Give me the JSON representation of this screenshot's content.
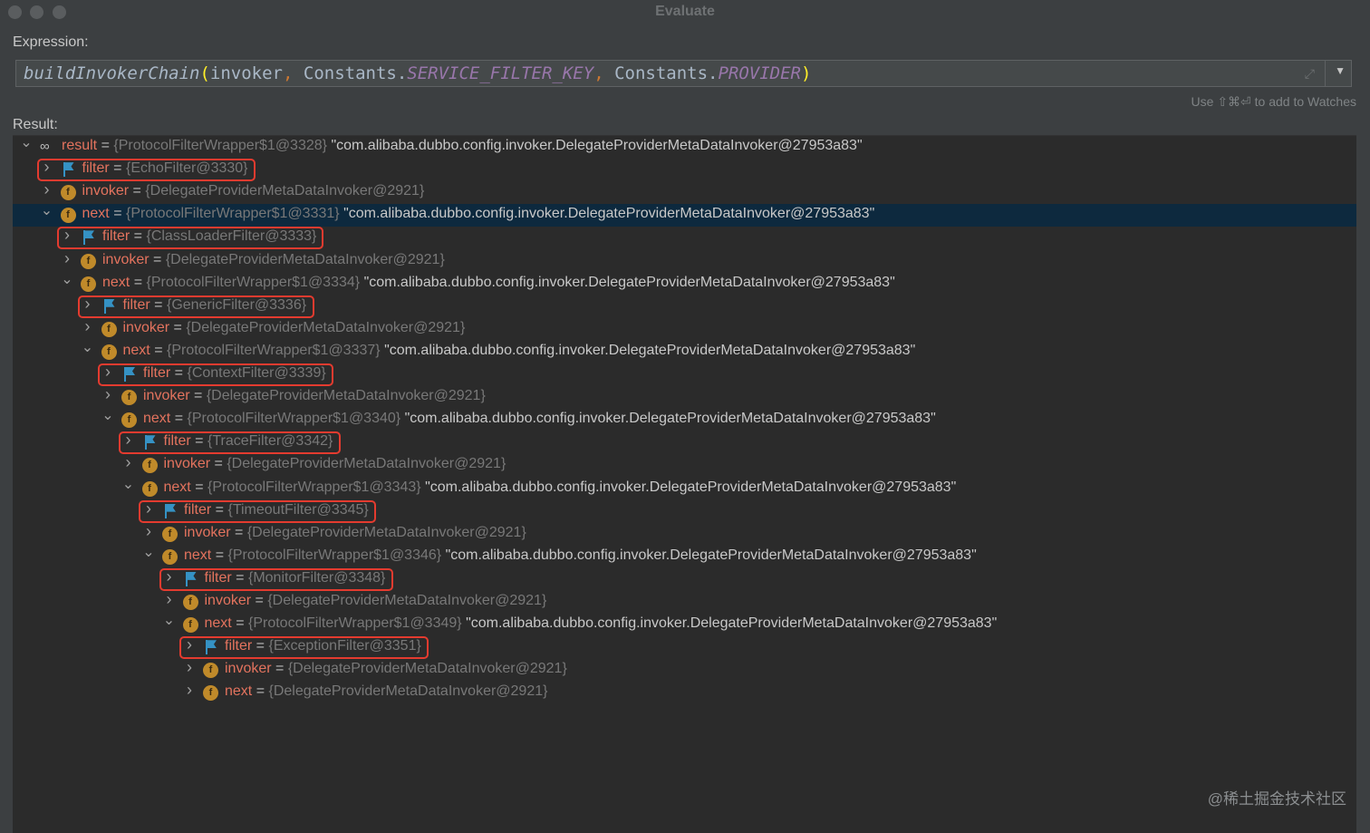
{
  "window": {
    "title": "Evaluate"
  },
  "expression": {
    "label": "Expression:",
    "fn": "buildInvokerChain",
    "open_paren": "(",
    "arg1": "invoker",
    "sep1": ", ",
    "class1": "Constants.",
    "const1": "SERVICE_FILTER_KEY",
    "sep2": ", ",
    "class2": "Constants.",
    "const2": "PROVIDER",
    "close_paren": ")"
  },
  "hint": "Use ⇧⌘⏎ to add to Watches",
  "result": {
    "label": "Result:",
    "rows": [
      {
        "depth": 0,
        "arrow": "down",
        "icon": "glasses",
        "name": "result",
        "type": "{ProtocolFilterWrapper$1@3328}",
        "str": "\"com.alibaba.dubbo.config.invoker.DelegateProviderMetaDataInvoker@27953a83\"",
        "selected": false,
        "highlight": false
      },
      {
        "depth": 1,
        "arrow": "right",
        "icon": "flag",
        "name": "filter",
        "type": "{EchoFilter@3330}",
        "str": "",
        "selected": false,
        "highlight": true
      },
      {
        "depth": 1,
        "arrow": "right",
        "icon": "field",
        "name": "invoker",
        "type": "{DelegateProviderMetaDataInvoker@2921}",
        "str": "",
        "selected": false,
        "highlight": false
      },
      {
        "depth": 1,
        "arrow": "down",
        "icon": "field",
        "name": "next",
        "type": "{ProtocolFilterWrapper$1@3331}",
        "str": "\"com.alibaba.dubbo.config.invoker.DelegateProviderMetaDataInvoker@27953a83\"",
        "selected": true,
        "highlight": false
      },
      {
        "depth": 2,
        "arrow": "right",
        "icon": "flag",
        "name": "filter",
        "type": "{ClassLoaderFilter@3333}",
        "str": "",
        "selected": false,
        "highlight": true
      },
      {
        "depth": 2,
        "arrow": "right",
        "icon": "field",
        "name": "invoker",
        "type": "{DelegateProviderMetaDataInvoker@2921}",
        "str": "",
        "selected": false,
        "highlight": false
      },
      {
        "depth": 2,
        "arrow": "down",
        "icon": "field",
        "name": "next",
        "type": "{ProtocolFilterWrapper$1@3334}",
        "str": "\"com.alibaba.dubbo.config.invoker.DelegateProviderMetaDataInvoker@27953a83\"",
        "selected": false,
        "highlight": false
      },
      {
        "depth": 3,
        "arrow": "right",
        "icon": "flag",
        "name": "filter",
        "type": "{GenericFilter@3336}",
        "str": "",
        "selected": false,
        "highlight": true
      },
      {
        "depth": 3,
        "arrow": "right",
        "icon": "field",
        "name": "invoker",
        "type": "{DelegateProviderMetaDataInvoker@2921}",
        "str": "",
        "selected": false,
        "highlight": false
      },
      {
        "depth": 3,
        "arrow": "down",
        "icon": "field",
        "name": "next",
        "type": "{ProtocolFilterWrapper$1@3337}",
        "str": "\"com.alibaba.dubbo.config.invoker.DelegateProviderMetaDataInvoker@27953a83\"",
        "selected": false,
        "highlight": false
      },
      {
        "depth": 4,
        "arrow": "right",
        "icon": "flag",
        "name": "filter",
        "type": "{ContextFilter@3339}",
        "str": "",
        "selected": false,
        "highlight": true
      },
      {
        "depth": 4,
        "arrow": "right",
        "icon": "field",
        "name": "invoker",
        "type": "{DelegateProviderMetaDataInvoker@2921}",
        "str": "",
        "selected": false,
        "highlight": false
      },
      {
        "depth": 4,
        "arrow": "down",
        "icon": "field",
        "name": "next",
        "type": "{ProtocolFilterWrapper$1@3340}",
        "str": "\"com.alibaba.dubbo.config.invoker.DelegateProviderMetaDataInvoker@27953a83\"",
        "selected": false,
        "highlight": false
      },
      {
        "depth": 5,
        "arrow": "right",
        "icon": "flag",
        "name": "filter",
        "type": "{TraceFilter@3342}",
        "str": "",
        "selected": false,
        "highlight": true
      },
      {
        "depth": 5,
        "arrow": "right",
        "icon": "field",
        "name": "invoker",
        "type": "{DelegateProviderMetaDataInvoker@2921}",
        "str": "",
        "selected": false,
        "highlight": false
      },
      {
        "depth": 5,
        "arrow": "down",
        "icon": "field",
        "name": "next",
        "type": "{ProtocolFilterWrapper$1@3343}",
        "str": "\"com.alibaba.dubbo.config.invoker.DelegateProviderMetaDataInvoker@27953a83\"",
        "selected": false,
        "highlight": false
      },
      {
        "depth": 6,
        "arrow": "right",
        "icon": "flag",
        "name": "filter",
        "type": "{TimeoutFilter@3345}",
        "str": "",
        "selected": false,
        "highlight": true
      },
      {
        "depth": 6,
        "arrow": "right",
        "icon": "field",
        "name": "invoker",
        "type": "{DelegateProviderMetaDataInvoker@2921}",
        "str": "",
        "selected": false,
        "highlight": false
      },
      {
        "depth": 6,
        "arrow": "down",
        "icon": "field",
        "name": "next",
        "type": "{ProtocolFilterWrapper$1@3346}",
        "str": "\"com.alibaba.dubbo.config.invoker.DelegateProviderMetaDataInvoker@27953a83\"",
        "selected": false,
        "highlight": false
      },
      {
        "depth": 7,
        "arrow": "right",
        "icon": "flag",
        "name": "filter",
        "type": "{MonitorFilter@3348}",
        "str": "",
        "selected": false,
        "highlight": true
      },
      {
        "depth": 7,
        "arrow": "right",
        "icon": "field",
        "name": "invoker",
        "type": "{DelegateProviderMetaDataInvoker@2921}",
        "str": "",
        "selected": false,
        "highlight": false
      },
      {
        "depth": 7,
        "arrow": "down",
        "icon": "field",
        "name": "next",
        "type": "{ProtocolFilterWrapper$1@3349}",
        "str": "\"com.alibaba.dubbo.config.invoker.DelegateProviderMetaDataInvoker@27953a83\"",
        "selected": false,
        "highlight": false
      },
      {
        "depth": 8,
        "arrow": "right",
        "icon": "flag",
        "name": "filter",
        "type": "{ExceptionFilter@3351}",
        "str": "",
        "selected": false,
        "highlight": true
      },
      {
        "depth": 8,
        "arrow": "right",
        "icon": "field",
        "name": "invoker",
        "type": "{DelegateProviderMetaDataInvoker@2921}",
        "str": "",
        "selected": false,
        "highlight": false
      },
      {
        "depth": 8,
        "arrow": "right",
        "icon": "field",
        "name": "next",
        "type": "{DelegateProviderMetaDataInvoker@2921}",
        "str": "",
        "selected": false,
        "highlight": false
      }
    ]
  },
  "colors": {
    "highlight_border": "#e43b2f",
    "selected_row": "#0d293e",
    "var_name": "#e3735e",
    "field_icon": "#c08a2a",
    "flag_icon": "#3592c4"
  },
  "watermark": "@稀土掘金技术社区"
}
